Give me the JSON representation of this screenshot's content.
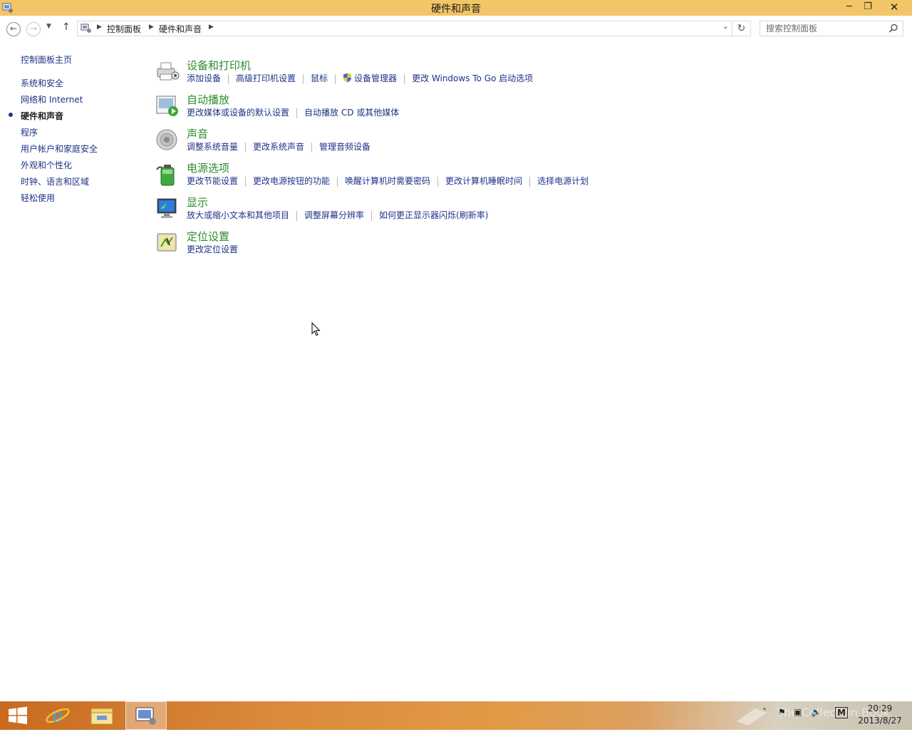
{
  "window": {
    "title": "硬件和声音",
    "controls": {
      "minimize": "─",
      "maximize": "❐",
      "close": "✕"
    }
  },
  "navigation": {
    "breadcrumbs": [
      "控制面板",
      "硬件和声音"
    ],
    "search_placeholder": "搜索控制面板"
  },
  "sidebar": {
    "home": "控制面板主页",
    "items": [
      {
        "label": "系统和安全",
        "current": false
      },
      {
        "label": "网络和 Internet",
        "current": false
      },
      {
        "label": "硬件和声音",
        "current": true
      },
      {
        "label": "程序",
        "current": false
      },
      {
        "label": "用户帐户和家庭安全",
        "current": false
      },
      {
        "label": "外观和个性化",
        "current": false
      },
      {
        "label": "时钟、语言和区域",
        "current": false
      },
      {
        "label": "轻松使用",
        "current": false
      }
    ]
  },
  "categories": [
    {
      "title": "设备和打印机",
      "icon": "printer-icon",
      "links": [
        "添加设备",
        "高级打印机设置",
        "鼠标",
        "设备管理器",
        "更改 Windows To Go 启动选项"
      ]
    },
    {
      "title": "自动播放",
      "icon": "autoplay-icon",
      "links": [
        "更改媒体或设备的默认设置",
        "自动播放 CD 或其他媒体"
      ]
    },
    {
      "title": "声音",
      "icon": "speaker-icon",
      "links": [
        "调整系统音量",
        "更改系统声音",
        "管理音频设备"
      ]
    },
    {
      "title": "电源选项",
      "icon": "battery-icon",
      "links": [
        "更改节能设置",
        "更改电源按钮的功能",
        "唤醒计算机时需要密码",
        "更改计算机睡眠时间",
        "选择电源计划"
      ]
    },
    {
      "title": "显示",
      "icon": "monitor-icon",
      "links": [
        "放大或缩小文本和其他项目",
        "调整屏幕分辨率",
        "如何更正显示器闪烁(刷新率)"
      ]
    },
    {
      "title": "定位设置",
      "icon": "location-icon",
      "links": [
        "更改定位设置"
      ]
    }
  ],
  "taskbar": {
    "time": "20:29",
    "date": "2013/8/27",
    "ime": "M",
    "watermark": "The Collection Book"
  },
  "colors": {
    "titlebar": "#f2c566",
    "link": "#1e3287",
    "category_title": "#2e8b2e"
  }
}
